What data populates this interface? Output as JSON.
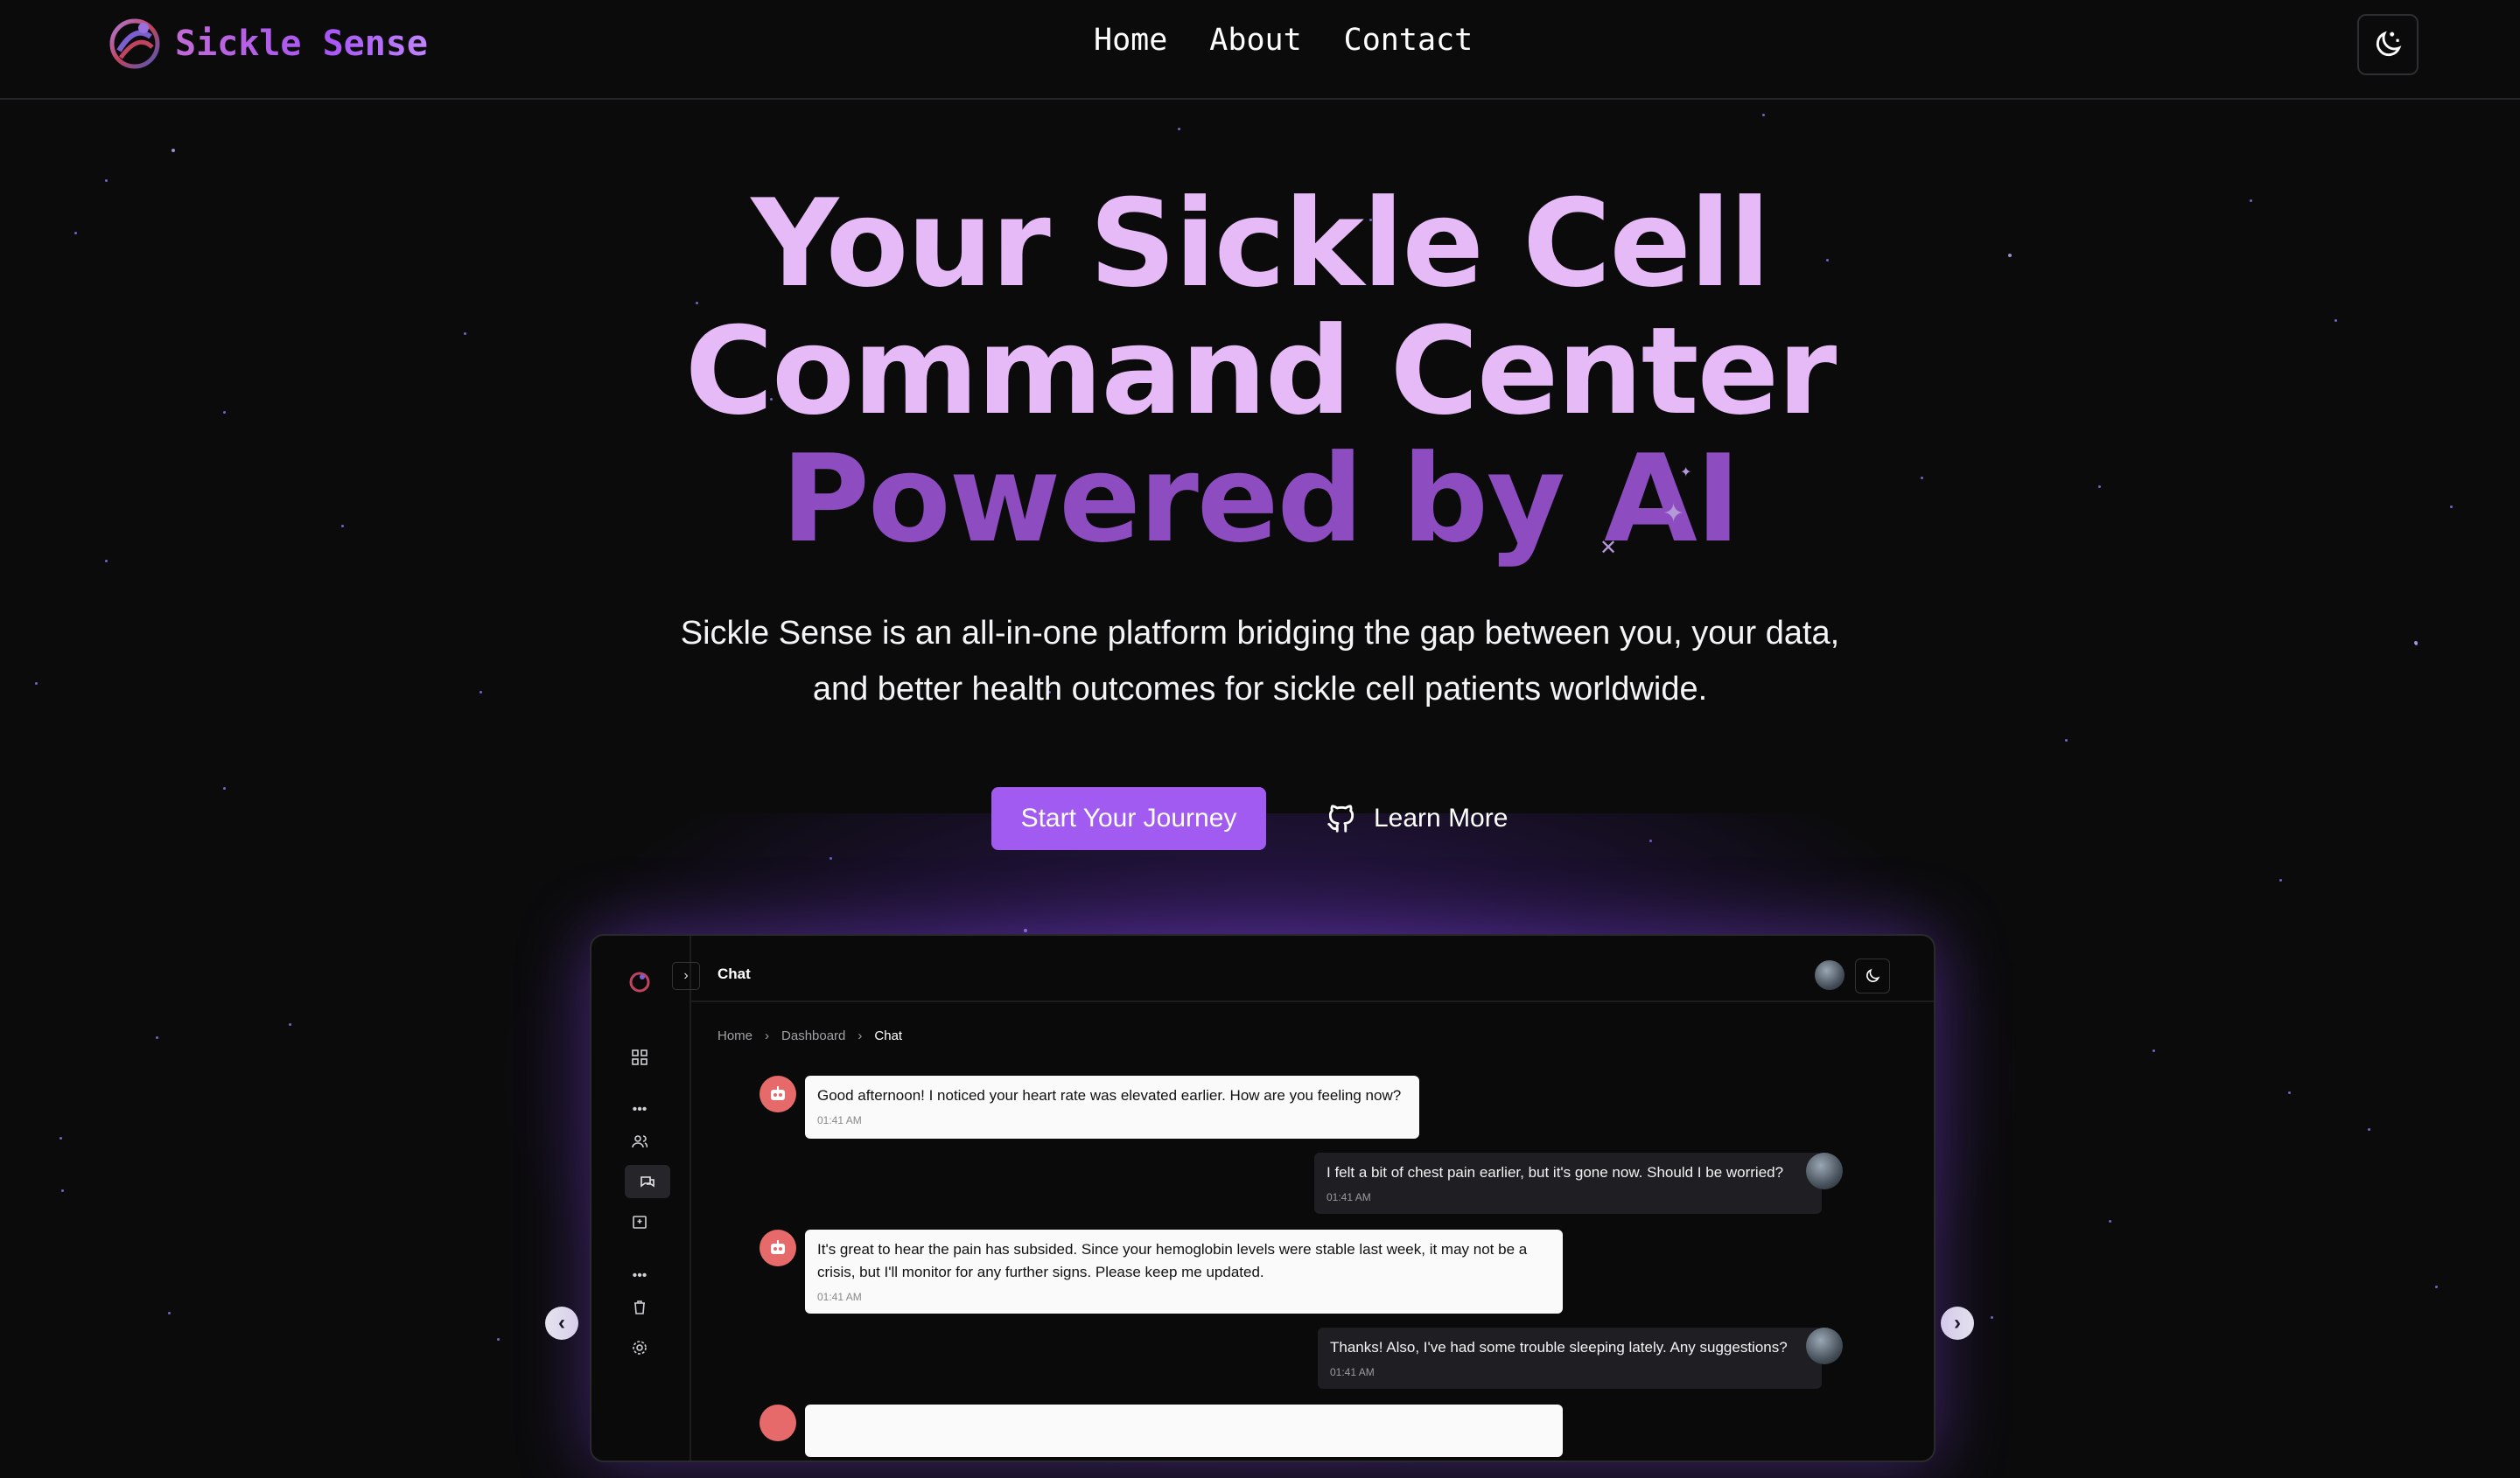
{
  "brand": {
    "name": "Sickle Sense"
  },
  "nav": {
    "items": [
      "Home",
      "About",
      "Contact"
    ]
  },
  "theme_toggle": {
    "icon": "moon-sparkle-icon"
  },
  "hero": {
    "line1": "Your Sickle Cell",
    "line2": "Command Center",
    "line3": "Powered by AI",
    "subtitle_line1": "Sickle Sense is an all-in-one platform bridging the gap between you, your data,",
    "subtitle_line2": "and better health outcomes for sickle cell patients worldwide.",
    "primary_cta": "Start Your Journey",
    "secondary_cta": "Learn More",
    "secondary_icon": "github-icon"
  },
  "colors": {
    "accent": "#a15bf1",
    "title_light": "#e6b9f7",
    "title_dark": "#8d4cc0",
    "background": "#0b0b0c"
  },
  "preview": {
    "header_title": "Chat",
    "breadcrumb": [
      "Home",
      "Dashboard",
      "Chat"
    ],
    "sidebar_icons": [
      "grid-icon",
      "more-icon",
      "users-icon",
      "chat-icon",
      "hospital-icon",
      "more-icon",
      "trash-icon",
      "settings-icon"
    ],
    "messages": [
      {
        "from": "bot",
        "text": "Good afternoon! I noticed your heart rate was elevated earlier. How are you feeling now?",
        "time": "01:41 AM"
      },
      {
        "from": "user",
        "text": "I felt a bit of chest pain earlier, but it's gone now. Should I be worried?",
        "time": "01:41 AM"
      },
      {
        "from": "bot",
        "text_line1": "It's great to hear the pain has subsided. Since your hemoglobin levels were stable last week, it may not be a",
        "text_line2": "crisis, but I'll monitor for any further signs. Please keep me updated.",
        "time": "01:41 AM"
      },
      {
        "from": "user",
        "text": "Thanks! Also, I've had some trouble sleeping lately. Any suggestions?",
        "time": "01:41 AM"
      }
    ]
  },
  "carousel": {
    "prev_icon": "chevron-left-icon",
    "next_icon": "chevron-right-icon"
  }
}
